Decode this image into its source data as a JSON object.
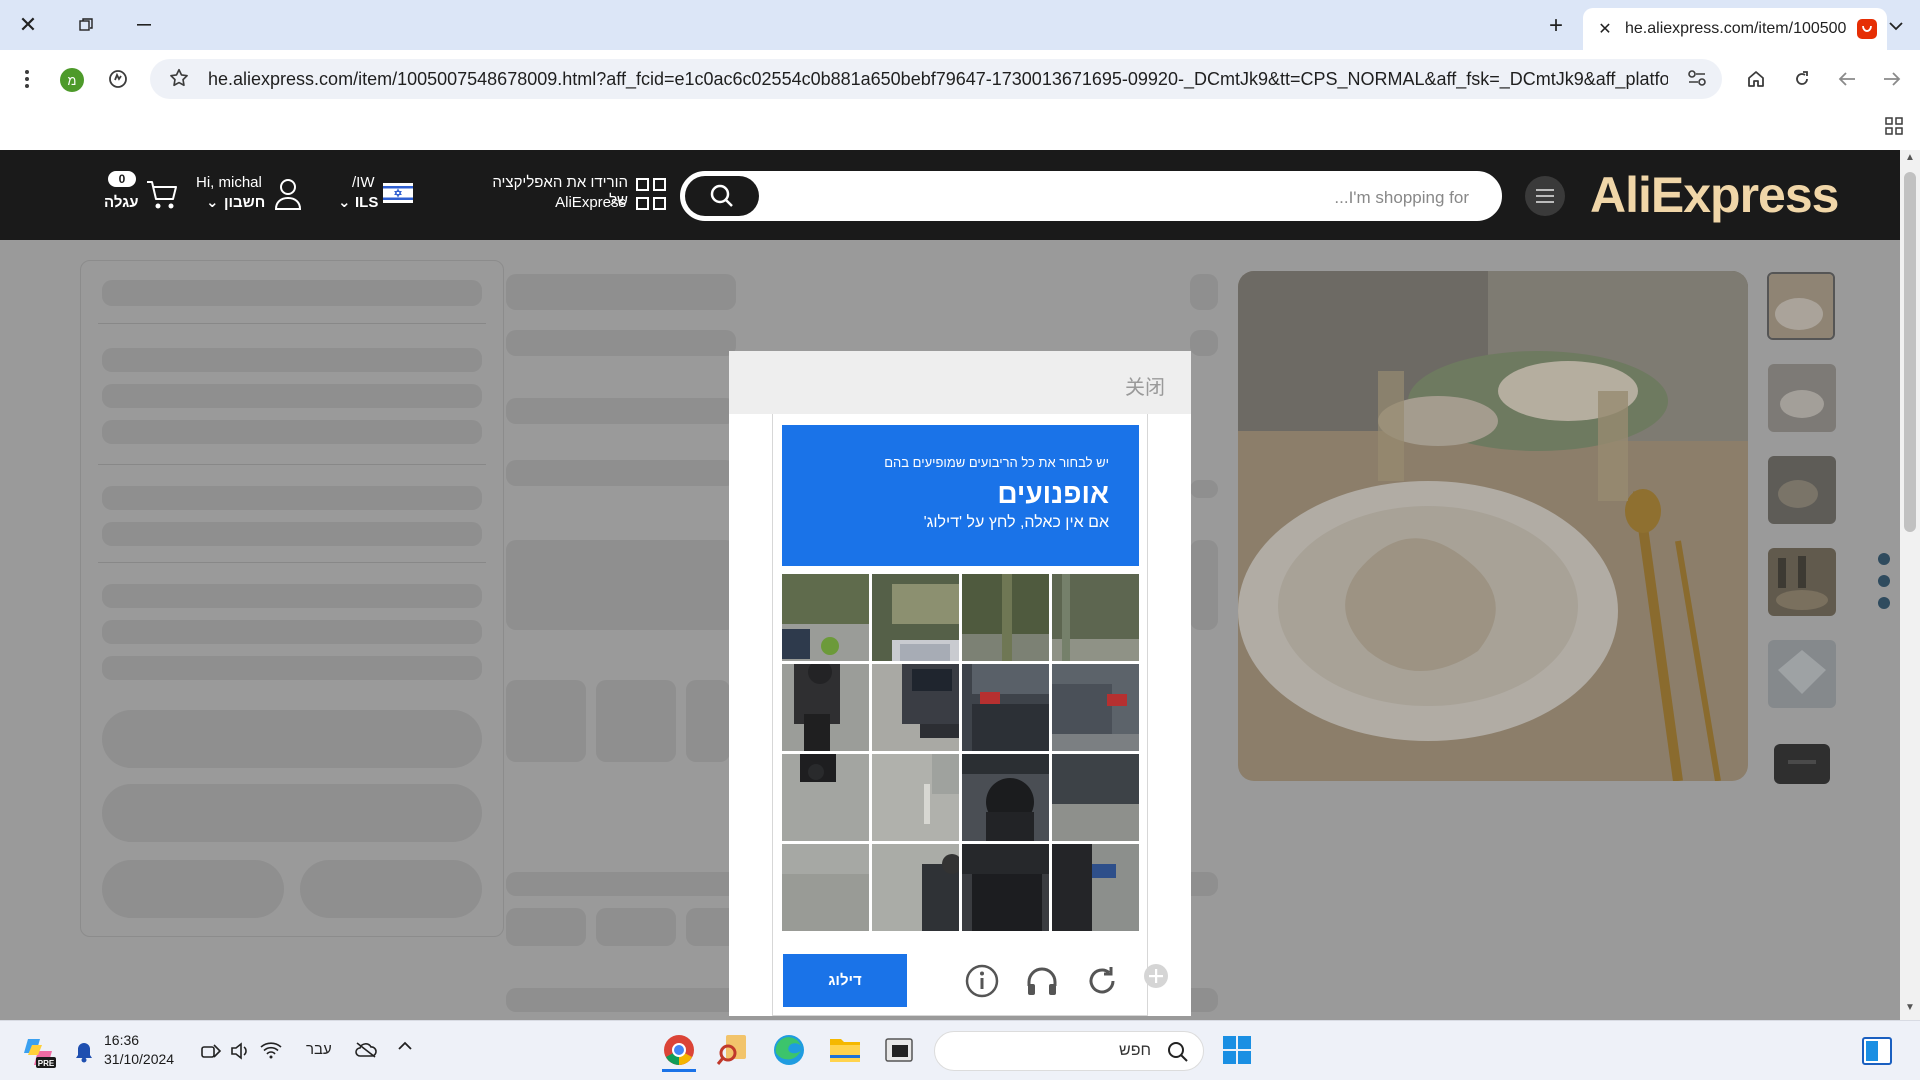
{
  "browser": {
    "tab_title": "he.aliexpress.com/item/100500",
    "url": "he.aliexpress.com/item/1005007548678009.html?aff_fcid=e1c0ac6c02554c0b881a650bebf79647-1730013671695-09920-_DCmtJk9&tt=CPS_NORMAL&aff_fsk=_DCmtJk9&aff_platform=shar...",
    "profile_initial": "מ"
  },
  "aliexpress": {
    "logo": "AliExpress",
    "search_placeholder": "...I'm shopping for",
    "app_promo_line1": "הורידו את האפליקציה של",
    "app_promo_line2": "AliExpress",
    "locale_line1": "/IW",
    "locale_line2": "ILS",
    "greeting": "Hi, michal",
    "account_label": "חשבון",
    "cart_count": "0",
    "cart_label": "עגלה"
  },
  "captcha": {
    "close_label": "关闭",
    "instruction_line1": "יש לבחור את כל הריבועים שמופיעים בהם",
    "target_object": "אופנועים",
    "instruction_line3": "אם אין כאלה, לחץ על 'דילוג'",
    "skip_button": "דילוג"
  },
  "taskbar": {
    "time": "16:36",
    "date": "31/10/2024",
    "language": "עבר",
    "search_placeholder": "חפש"
  },
  "colors": {
    "captcha_blue": "#1a73e8",
    "header_black": "#1a1a1a",
    "overlay_gray": "#9a9a9a"
  }
}
